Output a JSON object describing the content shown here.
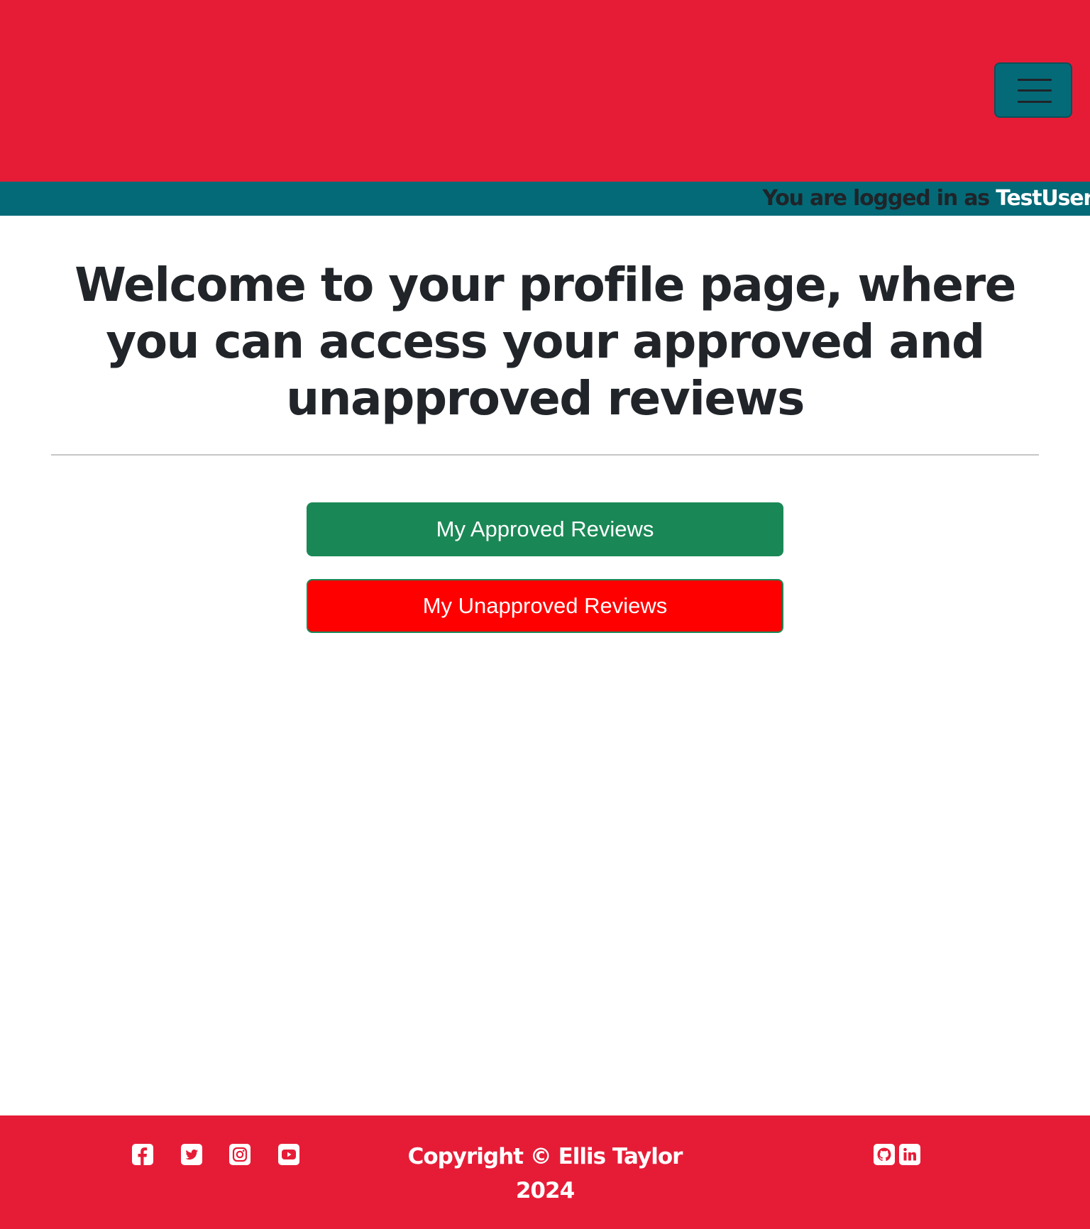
{
  "navbar": {
    "background_color": "#e61c37",
    "toggler_icon": "hamburger-menu-icon",
    "toggler_color": "#056a77"
  },
  "login_status": {
    "prefix": "You are logged in as",
    "username": "TestUser",
    "background_color": "#046a77"
  },
  "main": {
    "heading": "Welcome to your profile page, where you can access your approved and unapproved reviews",
    "buttons": {
      "approved_label": "My Approved Reviews",
      "approved_color": "#1a8856",
      "unapproved_label": "My Unapproved Reviews",
      "unapproved_color": "#ff0000"
    }
  },
  "footer": {
    "background_color": "#e61c37",
    "social_icons": [
      "facebook-icon",
      "twitter-icon",
      "instagram-icon",
      "youtube-icon"
    ],
    "copyright": "Copyright © Ellis Taylor 2024",
    "developer_icons": [
      "github-icon",
      "linkedin-icon"
    ]
  }
}
